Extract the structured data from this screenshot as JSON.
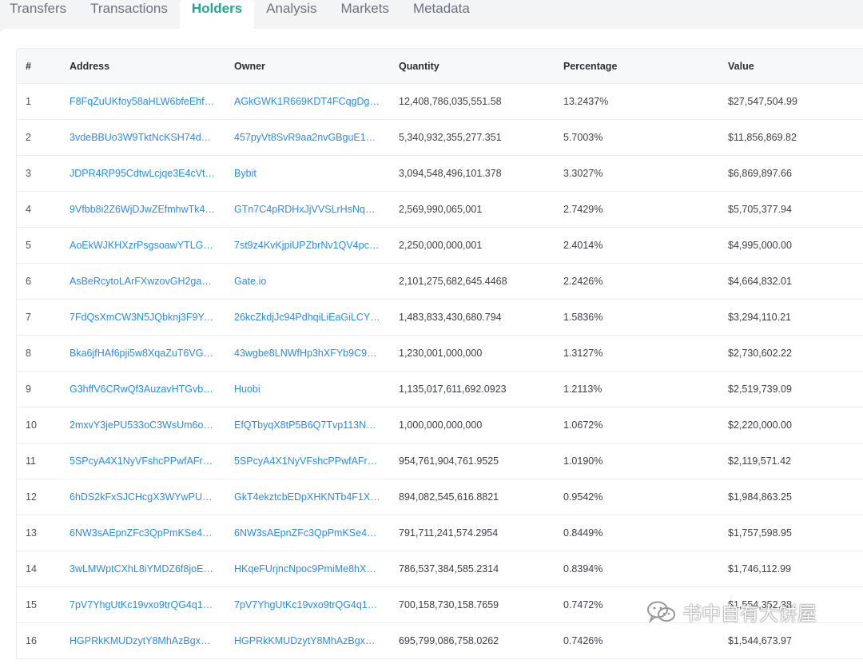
{
  "tabs": [
    {
      "label": "Transfers"
    },
    {
      "label": "Transactions"
    },
    {
      "label": "Holders"
    },
    {
      "label": "Analysis"
    },
    {
      "label": "Markets"
    },
    {
      "label": "Metadata"
    }
  ],
  "active_tab": "Holders",
  "table": {
    "headers": {
      "rank": "#",
      "address": "Address",
      "owner": "Owner",
      "quantity": "Quantity",
      "percentage": "Percentage",
      "value": "Value"
    },
    "rows": [
      {
        "rank": "1",
        "address": "F8FqZuUKfoy58aHLW6bfeEhf…",
        "owner": "AGkGWK1R669KDT4FCqgDgK…",
        "quantity": "12,408,786,035,551.58",
        "percentage": "13.2437%",
        "value": "$27,547,504.99"
      },
      {
        "rank": "2",
        "address": "3vdeBBUo3W9TktNcKSH74d4…",
        "owner": "457pyVt8SvR9aa2nvGBguE1m…",
        "quantity": "5,340,932,355,277.351",
        "percentage": "5.7003%",
        "value": "$11,856,869.82"
      },
      {
        "rank": "3",
        "address": "JDPR4RP95CdtwLcjqe3E4cVt…",
        "owner": "Bybit",
        "quantity": "3,094,548,496,101.378",
        "percentage": "3.3027%",
        "value": "$6,869,897.66"
      },
      {
        "rank": "4",
        "address": "9Vfbb8i2Z6WjDJwZEfmhwTk4…",
        "owner": "GTn7C4pRDHxJjVVSLrHsNq3…",
        "quantity": "2,569,990,065,001",
        "percentage": "2.7429%",
        "value": "$5,705,377.94"
      },
      {
        "rank": "5",
        "address": "AoEkWJKHXzrPsgsoawYTLG3…",
        "owner": "7st9z4KvKjpiUPZbrNv1QV4pc…",
        "quantity": "2,250,000,000,001",
        "percentage": "2.4014%",
        "value": "$4,995,000.00"
      },
      {
        "rank": "6",
        "address": "AsBeRcytoLArFXwzovGH2ga…",
        "owner": "Gate.io",
        "quantity": "2,101,275,682,645.4468",
        "percentage": "2.2426%",
        "value": "$4,664,832.01"
      },
      {
        "rank": "7",
        "address": "7FdQsXmCW3N5JQbknj3F9Yq…",
        "owner": "26kcZkdjJc94PdhqiLiEaGiLCY…",
        "quantity": "1,483,833,430,680.794",
        "percentage": "1.5836%",
        "value": "$3,294,110.21"
      },
      {
        "rank": "8",
        "address": "Bka6jfHAf6pji5w8XqaZuT6VG…",
        "owner": "43wgbe8LNWfHp3hXFYb9C9V…",
        "quantity": "1,230,001,000,000",
        "percentage": "1.3127%",
        "value": "$2,730,602.22"
      },
      {
        "rank": "9",
        "address": "G3hffV6CRwQf3AuzavHTGvbY…",
        "owner": "Huobi",
        "quantity": "1,135,017,611,692.0923",
        "percentage": "1.2113%",
        "value": "$2,519,739.09"
      },
      {
        "rank": "10",
        "address": "2mxvY3jePU533oC3WsUm6o…",
        "owner": "EfQTbyqX8tP5B6Q7Tvp113Na…",
        "quantity": "1,000,000,000,000",
        "percentage": "1.0672%",
        "value": "$2,220,000.00"
      },
      {
        "rank": "11",
        "address": "5SPcyA4X1NyVFshcPPwfAFr…",
        "owner": "5SPcyA4X1NyVFshcPPwfAFr…",
        "quantity": "954,761,904,761.9525",
        "percentage": "1.0190%",
        "value": "$2,119,571.42"
      },
      {
        "rank": "12",
        "address": "6hDS2kFxSJCHcgX3WYwPUL…",
        "owner": "GkT4ekztcbEDpXHKNTb4F1X…",
        "quantity": "894,082,545,616.8821",
        "percentage": "0.9542%",
        "value": "$1,984,863.25"
      },
      {
        "rank": "13",
        "address": "6NW3sAEpnZFc3QpPmKSe4hj…",
        "owner": "6NW3sAEpnZFc3QpPmKSe4hj…",
        "quantity": "791,711,241,574.2954",
        "percentage": "0.8449%",
        "value": "$1,757,598.95"
      },
      {
        "rank": "14",
        "address": "3wLMWptCXhL8iYMDZ6f8joE…",
        "owner": "HKqeFUrjncNpoc9PmiMe8hX…",
        "quantity": "786,537,384,585.2314",
        "percentage": "0.8394%",
        "value": "$1,746,112.99"
      },
      {
        "rank": "15",
        "address": "7pV7YhgUtKc19vxo9trQG4q1…",
        "owner": "7pV7YhgUtKc19vxo9trQG4q1…",
        "quantity": "700,158,730,158.7659",
        "percentage": "0.7472%",
        "value": "$1,554,352.38"
      },
      {
        "rank": "16",
        "address": "HGPRkKMUDzytY8MhAzBgxbi…",
        "owner": "HGPRkKMUDzytY8MhAzBgxbi…",
        "quantity": "695,799,086,758.0262",
        "percentage": "0.7426%",
        "value": "$1,544,673.97"
      }
    ]
  },
  "watermark": {
    "text": "书中自有大饼屋",
    "icon": "wechat-icon"
  },
  "colors": {
    "accent": "#1aaa8c",
    "link": "#2a8bf2"
  }
}
